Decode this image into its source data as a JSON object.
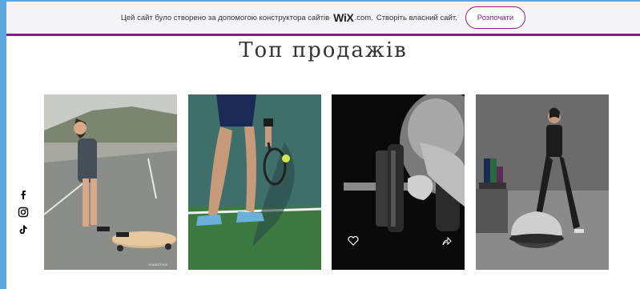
{
  "banner": {
    "text_before": "Цей сайт було створено за допомогою конструктора сайтів",
    "brand": "WiX",
    "brand_suffix": ".com.",
    "text_after": "Створіть власний сайт.",
    "cta_label": "Розпочати"
  },
  "section": {
    "title": "Топ продажів"
  },
  "products": [
    {
      "name": "skateboard-girl-image"
    },
    {
      "name": "tennis-player-image"
    },
    {
      "name": "dumbbell-image"
    },
    {
      "name": "bosu-ball-image"
    }
  ],
  "social": [
    "facebook-icon",
    "instagram-icon",
    "tiktok-icon"
  ],
  "colors": {
    "accent": "#8a1b86",
    "banner_bg": "#f4f4f6",
    "outer": "#5aa8e0"
  }
}
